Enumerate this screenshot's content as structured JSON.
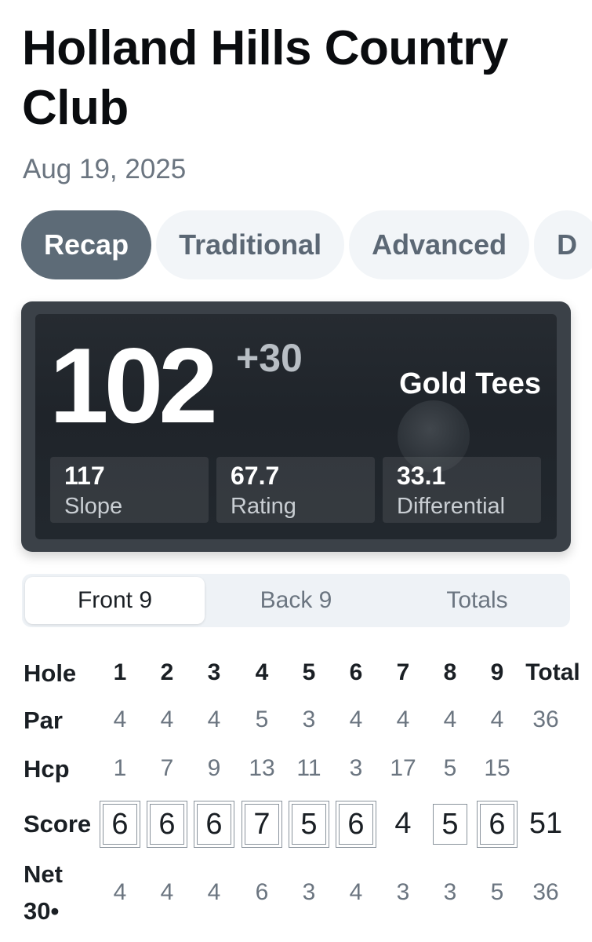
{
  "course": {
    "title": "Holland Hills Country Club",
    "date": "Aug 19, 2025"
  },
  "tabs": [
    "Recap",
    "Traditional",
    "Advanced",
    "D"
  ],
  "summary": {
    "score": "102",
    "over_par": "+30",
    "tees": "Gold Tees",
    "slope_value": "117",
    "slope_label": "Slope",
    "rating_value": "67.7",
    "rating_label": "Rating",
    "differential_value": "33.1",
    "differential_label": "Differential"
  },
  "segment": {
    "front": "Front 9",
    "back": "Back 9",
    "totals": "Totals"
  },
  "scorecard": {
    "labels": {
      "hole": "Hole",
      "par": "Par",
      "hcp": "Hcp",
      "score": "Score",
      "net": "Net",
      "net_sub": "30•"
    },
    "holes": [
      "1",
      "2",
      "3",
      "4",
      "5",
      "6",
      "7",
      "8",
      "9"
    ],
    "total_label": "Total",
    "par": [
      "4",
      "4",
      "4",
      "5",
      "3",
      "4",
      "4",
      "4",
      "4"
    ],
    "par_total": "36",
    "hcp": [
      "1",
      "7",
      "9",
      "13",
      "11",
      "3",
      "17",
      "5",
      "15"
    ],
    "score": [
      "6",
      "6",
      "6",
      "7",
      "5",
      "6",
      "4",
      "5",
      "6"
    ],
    "score_total": "51",
    "net": [
      "4",
      "4",
      "4",
      "6",
      "3",
      "4",
      "3",
      "3",
      "5"
    ],
    "net_total": "36"
  }
}
